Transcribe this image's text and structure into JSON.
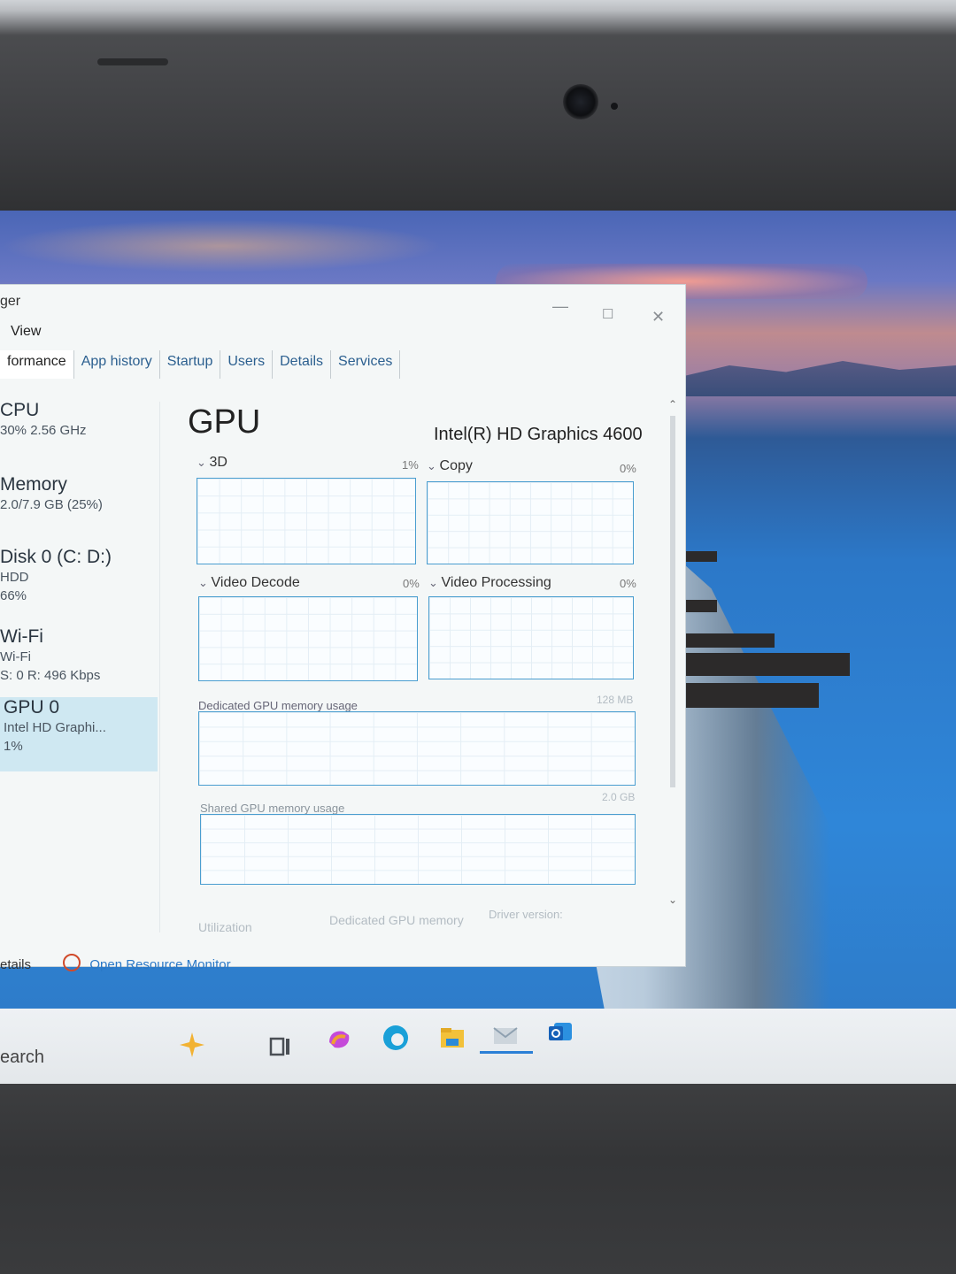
{
  "window": {
    "title_partial": "ger",
    "menu": [
      "View"
    ],
    "tabs": [
      "formance",
      "App history",
      "Startup",
      "Users",
      "Details",
      "Services"
    ]
  },
  "left_pane": {
    "items": [
      {
        "title": "CPU",
        "sub1": "30% 2.56 GHz",
        "sub2": "",
        "sub3": ""
      },
      {
        "title": "Memory",
        "sub1": "2.0/7.9 GB (25%)",
        "sub2": "",
        "sub3": ""
      },
      {
        "title": "Disk 0 (C: D:)",
        "sub1": "HDD",
        "sub2": "66%",
        "sub3": ""
      },
      {
        "title": "Wi-Fi",
        "sub1": "Wi-Fi",
        "sub2": "S: 0 R: 496 Kbps",
        "sub3": ""
      },
      {
        "title": "GPU 0",
        "sub1": "Intel HD Graphi...",
        "sub2": "1%",
        "sub3": ""
      }
    ]
  },
  "gpu": {
    "title": "GPU",
    "name": "Intel(R) HD Graphics 4600",
    "engines": [
      {
        "label": "3D",
        "pct": "1%"
      },
      {
        "label": "Copy",
        "pct": "0%"
      },
      {
        "label": "Video Decode",
        "pct": "0%"
      },
      {
        "label": "Video Processing",
        "pct": "0%"
      }
    ],
    "dedicated_label": "Dedicated GPU memory usage",
    "dedicated_max": "128 MB",
    "shared_label": "Shared GPU memory usage",
    "shared_max": "2.0 GB",
    "stats": [
      "Utilization",
      "Dedicated GPU memory",
      "Driver version:"
    ]
  },
  "footer": {
    "details": "etails",
    "resource_monitor": "Open Resource Monitor"
  },
  "taskbar": {
    "search": "earch",
    "icons": [
      "copilot-icon",
      "task-view-icon",
      "copilot-app-icon",
      "edge-icon",
      "file-explorer-icon",
      "mail-icon",
      "outlook-icon"
    ]
  }
}
